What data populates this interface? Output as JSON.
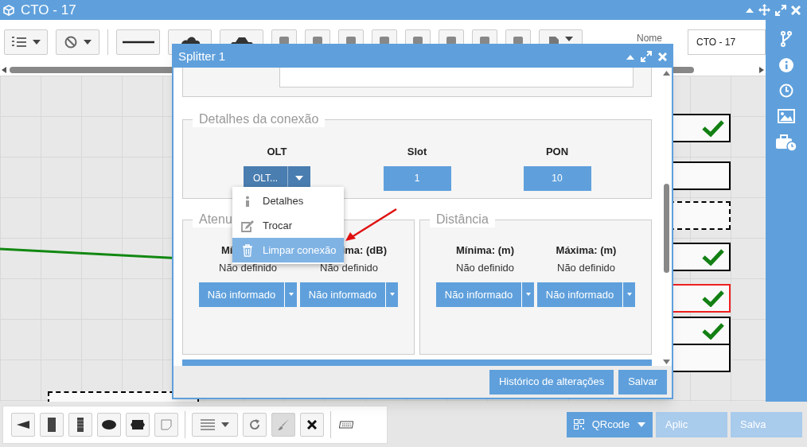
{
  "window": {
    "title": "CTO - 17"
  },
  "toolbar": {
    "name_label": "Nome",
    "name_value": "CTO - 17"
  },
  "canvas": {
    "boxes": [
      {
        "kind": "solid",
        "checked": true
      },
      {
        "kind": "solid",
        "checked": false
      },
      {
        "kind": "dashed",
        "checked": false
      },
      {
        "kind": "solid",
        "checked": true
      },
      {
        "kind": "alert",
        "checked": true
      },
      {
        "kind": "solid",
        "checked": true
      },
      {
        "kind": "solid",
        "checked": false
      },
      {
        "kind": "dashed",
        "checked": false
      }
    ]
  },
  "dialog": {
    "title": "Splitter 1",
    "connection": {
      "legend": "Detalhes da conexão",
      "fields": [
        {
          "label": "OLT",
          "value": "OLT...",
          "kind": "dropdown"
        },
        {
          "label": "Slot",
          "value": "1",
          "kind": "plain"
        },
        {
          "label": "PON",
          "value": "10",
          "kind": "plain"
        }
      ]
    },
    "menu": [
      {
        "label": "Detalhes",
        "selected": false
      },
      {
        "label": "Trocar",
        "selected": false
      },
      {
        "label": "Limpar conexão",
        "selected": true
      }
    ],
    "attenuation": {
      "legend": "Atenu",
      "columns": [
        {
          "label": "Mí",
          "value": "Não definido",
          "button": "Não informado"
        },
        {
          "label": "ima: (dB)",
          "value": "Não definido",
          "button": "Não informado"
        }
      ]
    },
    "distance": {
      "legend": "Distância",
      "columns": [
        {
          "label": "Mínima: (m)",
          "value": "Não definido",
          "button": "Não informado"
        },
        {
          "label": "Máxima: (m)",
          "value": "Não definido",
          "button": "Não informado"
        }
      ]
    },
    "footer_buttons": [
      "Histórico de alterações",
      "Salvar"
    ]
  },
  "bottom_bar": {
    "qr_button": "QRcode",
    "buttons": [
      "Aplic",
      "Salva"
    ]
  }
}
